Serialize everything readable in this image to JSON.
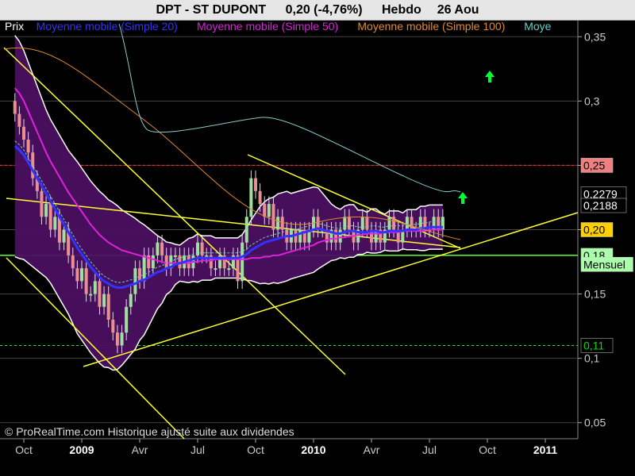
{
  "header": {
    "symbol": "DPT - ST DUPONT",
    "quote": "0,20 (-4,76%)",
    "period": "Hebdo",
    "date": "26 Aou"
  },
  "legend": [
    {
      "label": "Prix",
      "color": "#ffffff"
    },
    {
      "label": "Moyenne mobile (Simple 20)",
      "color": "#3333ff"
    },
    {
      "label": "Moyenne mobile (Simple 50)",
      "color": "#dd22dd"
    },
    {
      "label": "Moyenne mobile (Simple 100)",
      "color": "#e08a2e"
    },
    {
      "label": "Moye",
      "color": "#66cccc"
    }
  ],
  "watermark": "© ProRealTime.com Historique ajusté suite aux dividendes",
  "right_labels": [
    {
      "text": "0,25",
      "bg": "#f08080",
      "fg": "#000000",
      "value": 0.25
    },
    {
      "text": "0,2279",
      "bg": "#000000",
      "fg": "#ffffff",
      "value": 0.2279
    },
    {
      "text": "0,2188",
      "bg": "#000000",
      "fg": "#ffffff",
      "value": 0.2188
    },
    {
      "text": "0,20",
      "bg": "#ffd000",
      "fg": "#000000",
      "value": 0.2
    },
    {
      "text": "0,18",
      "bg": "#aaffaa",
      "fg": "#000000",
      "value": 0.18
    },
    {
      "text": "Mensuel",
      "bg": "#aaffaa",
      "fg": "#000000",
      "value": 0.173
    },
    {
      "text": "0,11",
      "bg": "#000000",
      "fg": "#00dd00",
      "value": 0.11
    }
  ],
  "chart_data": {
    "type": "candlestick",
    "title": "DPT - ST DUPONT 0,20 (-4,76%) Hebdo 26 Aou",
    "y_ticks": [
      "0,05",
      "0,1",
      "0,15",
      "0,2",
      "0,25",
      "0,3",
      "0,35"
    ],
    "y_tick_values": [
      0.05,
      0.1,
      0.15,
      0.2,
      0.25,
      0.3,
      0.35
    ],
    "ylim": [
      0.0375,
      0.3625
    ],
    "x_ticks": [
      {
        "label": "Oct",
        "year": false
      },
      {
        "label": "2009",
        "year": true
      },
      {
        "label": "Avr",
        "year": false
      },
      {
        "label": "Jul",
        "year": false
      },
      {
        "label": "Oct",
        "year": false
      },
      {
        "label": "2010",
        "year": true
      },
      {
        "label": "Avr",
        "year": false
      },
      {
        "label": "Jul",
        "year": false
      },
      {
        "label": "Oct",
        "year": false
      },
      {
        "label": "2011",
        "year": true
      }
    ],
    "x_tick_weeks": [
      0,
      13,
      26,
      39,
      52,
      65,
      78,
      91,
      104,
      117
    ],
    "horizontal_lines": [
      {
        "value": 0.25,
        "color": "#ff3333",
        "dashed": true
      },
      {
        "value": 0.18,
        "color": "#66ff33",
        "dashed": false
      },
      {
        "value": 0.11,
        "color": "#33dd33",
        "dashed": true
      }
    ],
    "close": [
      0.29,
      0.28,
      0.27,
      0.26,
      0.24,
      0.23,
      0.21,
      0.22,
      0.2,
      0.21,
      0.19,
      0.2,
      0.18,
      0.17,
      0.16,
      0.17,
      0.15,
      0.15,
      0.16,
      0.14,
      0.15,
      0.13,
      0.12,
      0.11,
      0.12,
      0.14,
      0.15,
      0.17,
      0.16,
      0.18,
      0.17,
      0.18,
      0.19,
      0.18,
      0.17,
      0.18,
      0.18,
      0.17,
      0.18,
      0.17,
      0.18,
      0.19,
      0.18,
      0.18,
      0.17,
      0.17,
      0.18,
      0.17,
      0.17,
      0.18,
      0.16,
      0.19,
      0.21,
      0.24,
      0.23,
      0.22,
      0.21,
      0.22,
      0.2,
      0.21,
      0.2,
      0.19,
      0.2,
      0.19,
      0.2,
      0.19,
      0.2,
      0.21,
      0.2,
      0.2,
      0.19,
      0.2,
      0.19,
      0.2,
      0.21,
      0.2,
      0.19,
      0.2,
      0.21,
      0.2,
      0.19,
      0.2,
      0.19,
      0.2,
      0.21,
      0.2,
      0.19,
      0.2,
      0.21,
      0.2,
      0.2,
      0.21,
      0.2,
      0.2,
      0.21,
      0.2,
      0.21
    ],
    "open": [
      0.3,
      0.29,
      0.28,
      0.27,
      0.26,
      0.24,
      0.23,
      0.21,
      0.22,
      0.2,
      0.21,
      0.19,
      0.2,
      0.18,
      0.17,
      0.16,
      0.17,
      0.15,
      0.15,
      0.16,
      0.14,
      0.15,
      0.13,
      0.12,
      0.11,
      0.12,
      0.14,
      0.15,
      0.17,
      0.16,
      0.18,
      0.17,
      0.18,
      0.19,
      0.18,
      0.17,
      0.18,
      0.18,
      0.17,
      0.18,
      0.17,
      0.18,
      0.19,
      0.18,
      0.18,
      0.17,
      0.17,
      0.18,
      0.17,
      0.17,
      0.18,
      0.16,
      0.19,
      0.21,
      0.24,
      0.23,
      0.22,
      0.21,
      0.22,
      0.2,
      0.21,
      0.2,
      0.19,
      0.2,
      0.19,
      0.2,
      0.19,
      0.2,
      0.21,
      0.2,
      0.2,
      0.19,
      0.2,
      0.19,
      0.2,
      0.21,
      0.2,
      0.19,
      0.2,
      0.21,
      0.2,
      0.19,
      0.2,
      0.19,
      0.2,
      0.21,
      0.2,
      0.19,
      0.2,
      0.21,
      0.2,
      0.2,
      0.21,
      0.2,
      0.2,
      0.21,
      0.2
    ],
    "ma20": [
      0.265,
      0.262,
      0.258,
      0.252,
      0.246,
      0.24,
      0.234,
      0.228,
      0.222,
      0.216,
      0.21,
      0.204,
      0.198,
      0.192,
      0.186,
      0.181,
      0.176,
      0.171,
      0.167,
      0.163,
      0.16,
      0.158,
      0.156,
      0.155,
      0.155,
      0.156,
      0.157,
      0.158,
      0.16,
      0.161,
      0.163,
      0.165,
      0.167,
      0.168,
      0.17,
      0.171,
      0.173,
      0.174,
      0.175,
      0.176,
      0.177,
      0.178,
      0.178,
      0.178,
      0.178,
      0.178,
      0.178,
      0.178,
      0.178,
      0.178,
      0.178,
      0.179,
      0.181,
      0.184,
      0.186,
      0.188,
      0.19,
      0.191,
      0.192,
      0.193,
      0.194,
      0.195,
      0.195,
      0.196,
      0.197,
      0.198,
      0.199,
      0.2,
      0.201,
      0.2,
      0.199,
      0.198,
      0.197,
      0.197,
      0.198,
      0.199,
      0.199,
      0.198,
      0.198,
      0.198,
      0.199,
      0.199,
      0.198,
      0.198,
      0.199,
      0.199,
      0.199,
      0.199,
      0.2,
      0.2,
      0.2,
      0.201,
      0.201,
      0.202,
      0.202,
      0.202,
      0.202
    ],
    "ma50": [
      0.31,
      0.306,
      0.3,
      0.292,
      0.284,
      0.276,
      0.268,
      0.26,
      0.253,
      0.247,
      0.241,
      0.235,
      0.229,
      0.224,
      0.219,
      0.214,
      0.209,
      0.204,
      0.2,
      0.196,
      0.193,
      0.19,
      0.188,
      0.186,
      0.184,
      0.183,
      0.182,
      0.181,
      0.18,
      0.179,
      0.178,
      0.177,
      0.176,
      0.175,
      0.174,
      0.174,
      0.174,
      0.174,
      0.174,
      0.174,
      0.175,
      0.175,
      0.176,
      0.176,
      0.176,
      0.177,
      0.177,
      0.177,
      0.177,
      0.177,
      0.177,
      0.177,
      0.177,
      0.178,
      0.178,
      0.178,
      0.179,
      0.179,
      0.18,
      0.18,
      0.181,
      0.182,
      0.183,
      0.184,
      0.185,
      0.186,
      0.187,
      0.188,
      0.19,
      0.191,
      0.192,
      0.193,
      0.193,
      0.194,
      0.194,
      0.195,
      0.195,
      0.196,
      0.196,
      0.197,
      0.197,
      0.197,
      0.197,
      0.198,
      0.198,
      0.198,
      0.198,
      0.199,
      0.199,
      0.199,
      0.199,
      0.199,
      0.199,
      0.2,
      0.2,
      0.2,
      0.2
    ]
  }
}
